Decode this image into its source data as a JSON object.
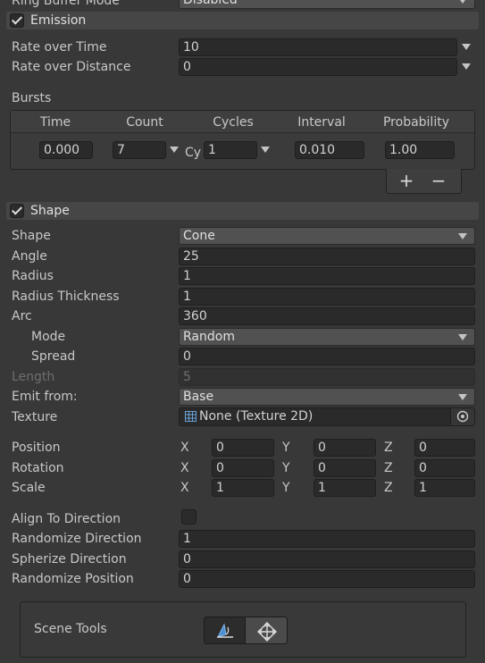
{
  "top": {
    "label": "Ring Buffer Mode",
    "value": "Disabled"
  },
  "emission": {
    "title": "Emission",
    "rate_over_time": {
      "label": "Rate over Time",
      "value": "10"
    },
    "rate_over_distance": {
      "label": "Rate over Distance",
      "value": "0"
    },
    "bursts": {
      "label": "Bursts",
      "headers": [
        "Time",
        "Count",
        "Cycles",
        "Interval",
        "Probability"
      ],
      "row": {
        "time": "0.000",
        "count": "7",
        "cycles_prefix": "Cy",
        "cycles": "1",
        "interval": "0.010",
        "probability": "1.00"
      },
      "add_symbol": "+",
      "remove_symbol": "−"
    }
  },
  "shape": {
    "title": "Shape",
    "shape": {
      "label": "Shape",
      "value": "Cone"
    },
    "angle": {
      "label": "Angle",
      "value": "25"
    },
    "radius": {
      "label": "Radius",
      "value": "1"
    },
    "radius_thickness": {
      "label": "Radius Thickness",
      "value": "1"
    },
    "arc": {
      "label": "Arc",
      "value": "360"
    },
    "mode": {
      "label": "Mode",
      "value": "Random"
    },
    "spread": {
      "label": "Spread",
      "value": "0"
    },
    "length": {
      "label": "Length",
      "value": "5"
    },
    "emit_from": {
      "label": "Emit from:",
      "value": "Base"
    },
    "texture": {
      "label": "Texture",
      "value": "None (Texture 2D)"
    },
    "axes": [
      "X",
      "Y",
      "Z"
    ],
    "position": {
      "label": "Position",
      "x": "0",
      "y": "0",
      "z": "0"
    },
    "rotation": {
      "label": "Rotation",
      "x": "0",
      "y": "0",
      "z": "0"
    },
    "scale": {
      "label": "Scale",
      "x": "1",
      "y": "1",
      "z": "1"
    },
    "align_to_direction": {
      "label": "Align To Direction",
      "checked": false
    },
    "randomize_direction": {
      "label": "Randomize Direction",
      "value": "1"
    },
    "spherize_direction": {
      "label": "Spherize Direction",
      "value": "0"
    },
    "randomize_position": {
      "label": "Randomize Position",
      "value": "0"
    }
  },
  "scene_tools": {
    "label": "Scene Tools"
  }
}
